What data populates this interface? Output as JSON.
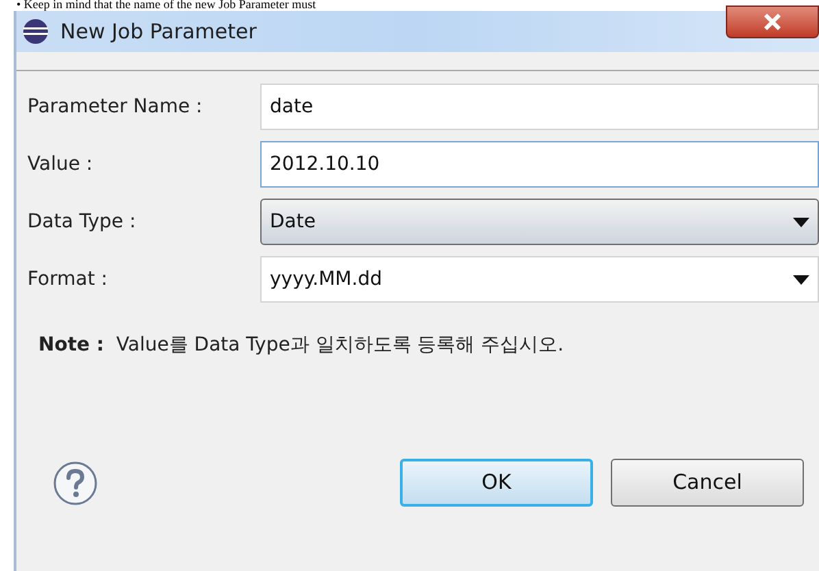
{
  "background_text": "• Keep in mind that the name of the new Job Parameter must",
  "window": {
    "title": "New Job Parameter"
  },
  "fields": [
    {
      "label": "Parameter Name :",
      "kind": "text",
      "value": "date",
      "focused": false
    },
    {
      "label": "Value :",
      "kind": "text",
      "value": "2012.10.10",
      "focused": true
    },
    {
      "label": "Data Type :",
      "kind": "dropdown",
      "value": "Date",
      "focused": false
    },
    {
      "label": "Format :",
      "kind": "combo",
      "value": "yyyy.MM.dd",
      "focused": false
    }
  ],
  "note": "**Note :**  Value를 Data Type과 일치하도록 등록해 주십시오.",
  "buttons": [
    {
      "label": "OK",
      "default": true
    },
    {
      "label": "Cancel",
      "default": false
    }
  ]
}
